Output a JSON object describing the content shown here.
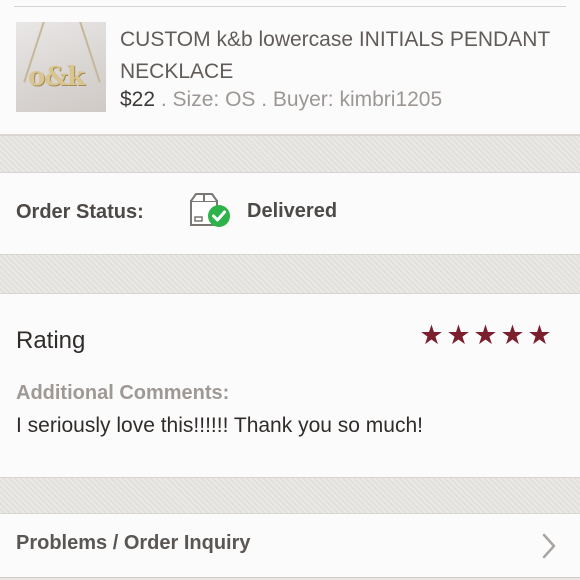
{
  "product": {
    "thumbnail_text": "o&k",
    "title": "CUSTOM k&b lowercase INITIALS PENDANT NECKLACE",
    "price": "$22",
    "meta_rest": " . Size: OS . Buyer: kimbri1205"
  },
  "order_status": {
    "label": "Order Status:",
    "icon": "delivered-package-icon",
    "value": "Delivered",
    "check_color": "#2eb34a"
  },
  "rating": {
    "label": "Rating",
    "stars": 5,
    "star_color": "#7b1f2d",
    "comments_label": "Additional Comments:",
    "comments": "I seriously love this!!!!!! Thank you so much!"
  },
  "problems": {
    "label": "Problems / Order Inquiry",
    "icon": "chevron-right-icon"
  }
}
